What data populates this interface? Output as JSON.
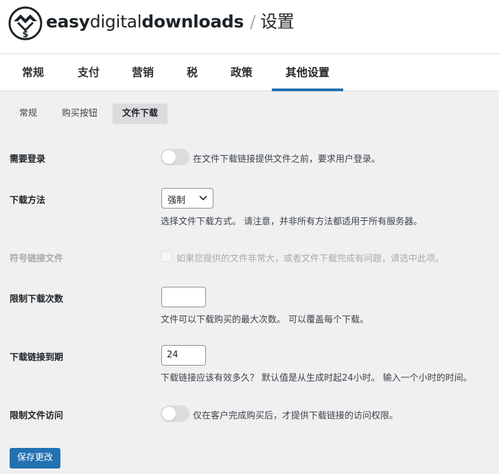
{
  "header": {
    "brand_easy": "easy",
    "brand_digital": "digital",
    "brand_downloads": "downloads",
    "separator": "/",
    "page_title": "设置"
  },
  "tabs": [
    {
      "label": "常规"
    },
    {
      "label": "支付"
    },
    {
      "label": "营销"
    },
    {
      "label": "税"
    },
    {
      "label": "政策"
    },
    {
      "label": "其他设置",
      "active": true
    }
  ],
  "subtabs": [
    {
      "label": "常规"
    },
    {
      "label": "购买按钮"
    },
    {
      "label": "文件下载",
      "active": true
    }
  ],
  "settings": {
    "require_login": {
      "label": "需要登录",
      "description": "在文件下载链接提供文件之前，要求用户登录。",
      "enabled": false
    },
    "download_method": {
      "label": "下载方法",
      "selected": "强制",
      "description": "选择文件下载方式。 请注意，并非所有方法都适用于所有服务器。"
    },
    "symlink": {
      "label": "符号链接文件",
      "description": "如果您提供的文件非常大，或者文件下载完成有问题，请选中此项。",
      "checked": false,
      "disabled": true
    },
    "download_limit": {
      "label": "限制下载次数",
      "value": "",
      "description": "文件可以下载购买的最大次数。 可以覆盖每个下载。"
    },
    "link_expiration": {
      "label": "下载链接到期",
      "value": "24",
      "description": "下载链接应该有效多久？ 默认值是从生成时起24小时。 输入一个小时的时间。"
    },
    "restrict_access": {
      "label": "限制文件访问",
      "description": "仅在客户完成购买后，才提供下载链接的访问权限。",
      "enabled": false
    }
  },
  "save_button": "保存更改",
  "colors": {
    "accent": "#2271b1",
    "background": "#f0f0f1",
    "toggle_off": "#dcdcde"
  }
}
